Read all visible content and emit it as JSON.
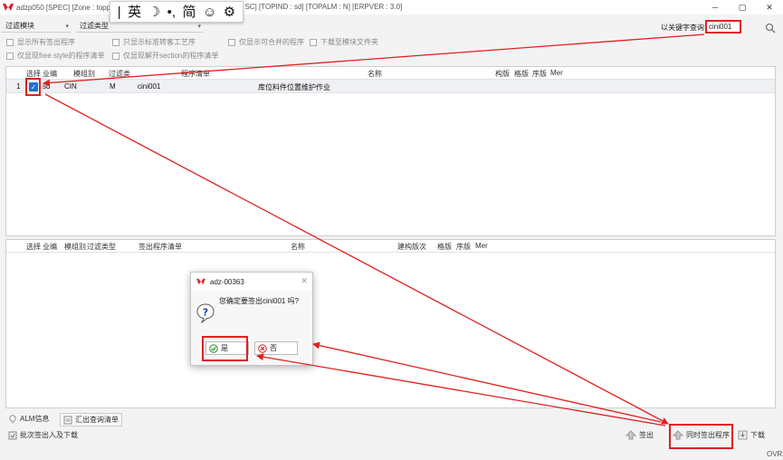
{
  "window": {
    "title_left": "adzp050 [SPEC] [Zone : toppro",
    "title_right": ": SC] [TOPIND : sd] [TOPALM : N] [ERPVER : 3.0]",
    "minimize": "─",
    "maximize": "▢",
    "close": "✕"
  },
  "ime": {
    "cursor": "|",
    "lang": "英",
    "moon": "☽",
    "punct": "•,",
    "simp": "简",
    "emoji": "☺",
    "settings": "⚙"
  },
  "filters": {
    "module_label": "过滤模块",
    "type_label": "过滤类型",
    "keyword_label": "以关键字查询",
    "keyword_value": "cini001"
  },
  "options": [
    "显示所有签出程序",
    "只显示标准转客工艺序",
    "仅显示可合并的程序",
    "下载至模块文件夹",
    "仅显现free style的程序清单",
    "仅显现解开section的程序清单"
  ],
  "top_grid": {
    "headers": [
      "选择",
      "业编",
      "模组别",
      "过滤类",
      "程序清单",
      "名称",
      "构版",
      "格版",
      "序版",
      "Mer"
    ],
    "row": {
      "index": "1",
      "checked": "✓",
      "owner": "sd",
      "module": "CIN",
      "type": "M",
      "program": "cini001",
      "name": "库位料件位置维护作业"
    }
  },
  "bottom_grid": {
    "headers": [
      "选择",
      "业编",
      "模组别",
      "过滤类型",
      "签出程序清单",
      "名称",
      "建构版次",
      "格版",
      "序版",
      "Mer"
    ]
  },
  "dialog": {
    "title": "adz-00363",
    "close": "✕",
    "message": "您确定要签出cini001 吗?",
    "yes": "是",
    "no": "否"
  },
  "bottom_tools": {
    "alm": "ALM信息",
    "export": "汇出查询清单",
    "batch": "批次签出入及下载",
    "checkout": "签出",
    "checkout_same": "同时签出程序",
    "download": "下载",
    "ovr": "OVR"
  },
  "colors": {
    "highlight": "#e02020",
    "brand": "#d9232d",
    "accent": "#1e6fd0"
  }
}
